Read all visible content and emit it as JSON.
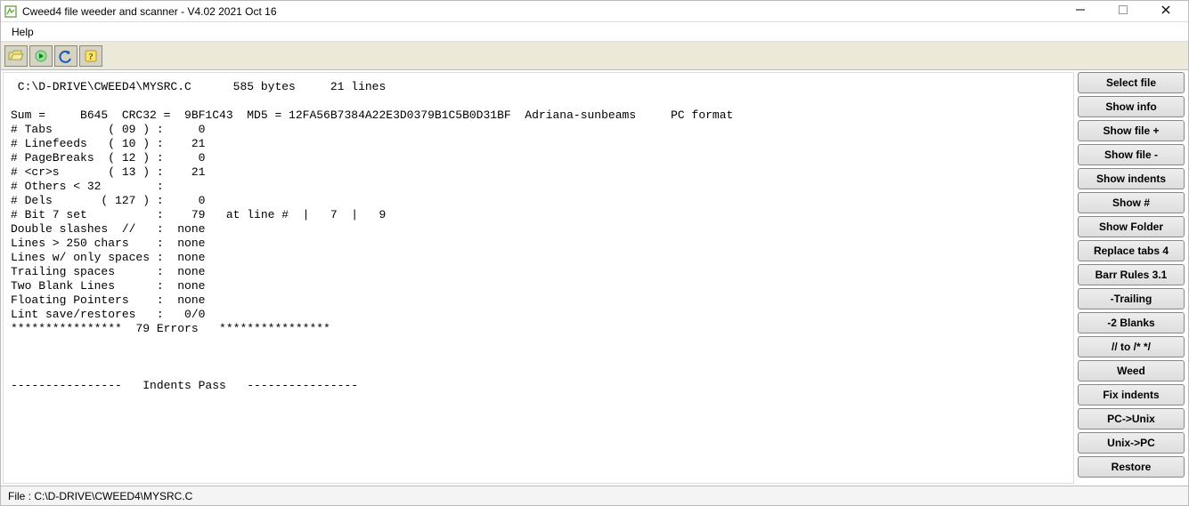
{
  "window": {
    "title": "Cweed4 file weeder and scanner - V4.02 2021 Oct 16"
  },
  "menu": {
    "help": "Help"
  },
  "content": " C:\\D-DRIVE\\CWEED4\\MYSRC.C      585 bytes     21 lines\n\nSum =     B645  CRC32 =  9BF1C43  MD5 = 12FA56B7384A22E3D0379B1C5B0D31BF  Adriana-sunbeams     PC format\n# Tabs        ( 09 ) :     0\n# Linefeeds   ( 10 ) :    21\n# PageBreaks  ( 12 ) :     0\n# <cr>s       ( 13 ) :    21\n# Others < 32        :\n# Dels       ( 127 ) :     0\n# Bit 7 set          :    79   at line #  |   7  |   9\nDouble slashes  //   :  none\nLines > 250 chars    :  none\nLines w/ only spaces :  none\nTrailing spaces      :  none\nTwo Blank Lines      :  none\nFloating Pointers    :  none\nLint save/restores   :   0/0\n****************  79 Errors   ****************\n\n\n\n----------------   Indents Pass   ----------------",
  "buttons": {
    "select_file": "Select file",
    "show_info": "Show info",
    "show_file_plus": "Show file +",
    "show_file_minus": "Show file -",
    "show_indents": "Show indents",
    "show_hash": "Show #",
    "show_folder": "Show Folder",
    "replace_tabs": "Replace tabs 4",
    "barr_rules": "Barr Rules 3.1",
    "trailing": "-Trailing",
    "blanks": "-2 Blanks",
    "slash_convert": "// to /* */",
    "weed": "Weed",
    "fix_indents": "Fix indents",
    "pc_unix": "PC->Unix",
    "unix_pc": "Unix->PC",
    "restore": "Restore"
  },
  "status": {
    "text": "File : C:\\D-DRIVE\\CWEED4\\MYSRC.C"
  }
}
